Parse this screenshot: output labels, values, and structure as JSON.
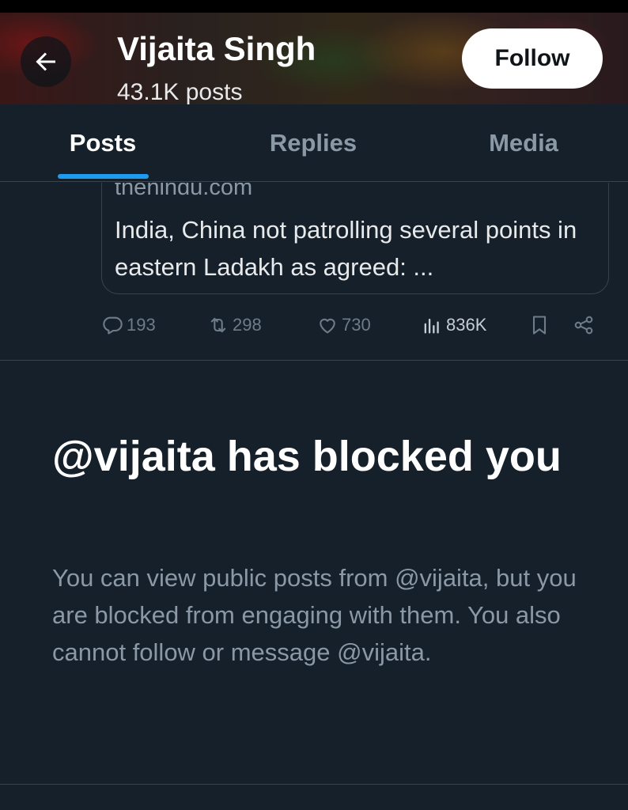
{
  "header": {
    "profile_name": "Vijaita Singh",
    "post_count": "43.1K posts",
    "follow_label": "Follow"
  },
  "tabs": [
    {
      "label": "Posts",
      "active": true
    },
    {
      "label": "Replies",
      "active": false
    },
    {
      "label": "Media",
      "active": false
    }
  ],
  "link_card": {
    "domain": "thehindu.com",
    "title": "India, China not patrolling several points in eastern Ladakh as agreed: ..."
  },
  "post_actions": {
    "replies": "193",
    "reposts": "298",
    "likes": "730",
    "views": "836K"
  },
  "blocked": {
    "title": "@vijaita has blocked you",
    "body": "You can view public posts from @vijaita, but you are blocked from engaging with them. You also cannot follow or message @vijaita."
  },
  "colors": {
    "background": "#15202b",
    "accent": "#1d9bf0",
    "muted_text": "#8b98a5",
    "border": "#38444d"
  }
}
